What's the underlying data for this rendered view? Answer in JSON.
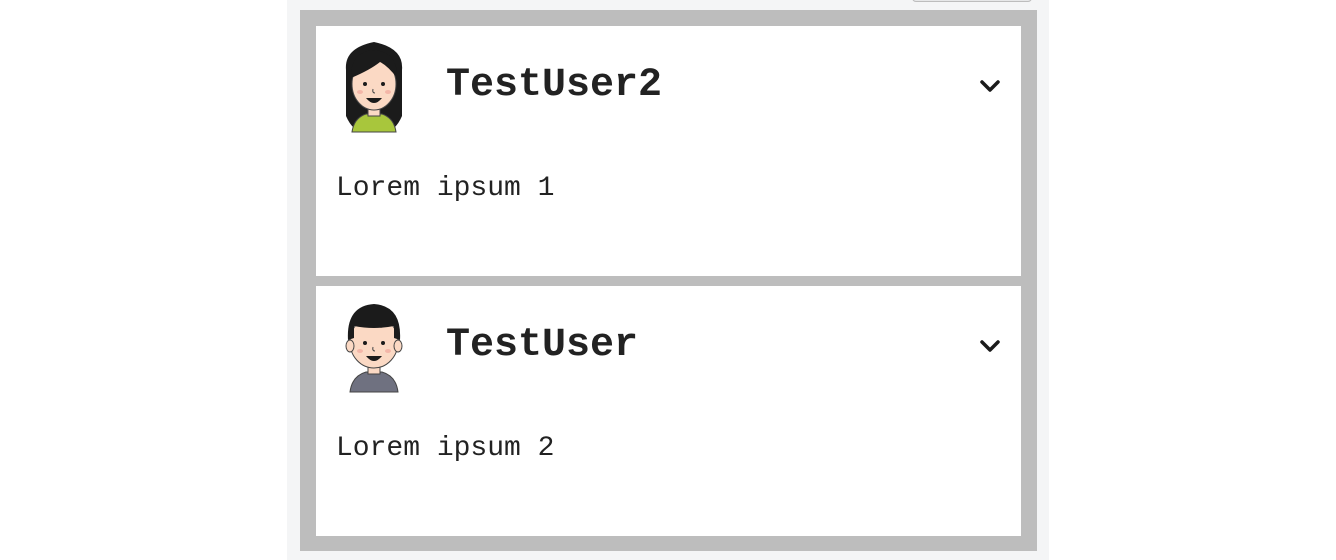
{
  "posts": [
    {
      "username": "TestUser2",
      "avatar_icon": "female-avatar-icon",
      "body": "Lorem ipsum 1",
      "expand_icon": "chevron-down-icon"
    },
    {
      "username": "TestUser",
      "avatar_icon": "male-avatar-icon",
      "body": "Lorem ipsum 2",
      "expand_icon": "chevron-down-icon"
    }
  ],
  "colors": {
    "page_background": "#ffffff",
    "column_background": "#f4f5f6",
    "feed_border": "#bdbdbd",
    "card_background": "#ffffff",
    "text": "#222222",
    "female_shirt": "#a8c63c",
    "male_shirt": "#6f7180",
    "skin": "#fbd9c4",
    "hair": "#1b1b1b"
  }
}
